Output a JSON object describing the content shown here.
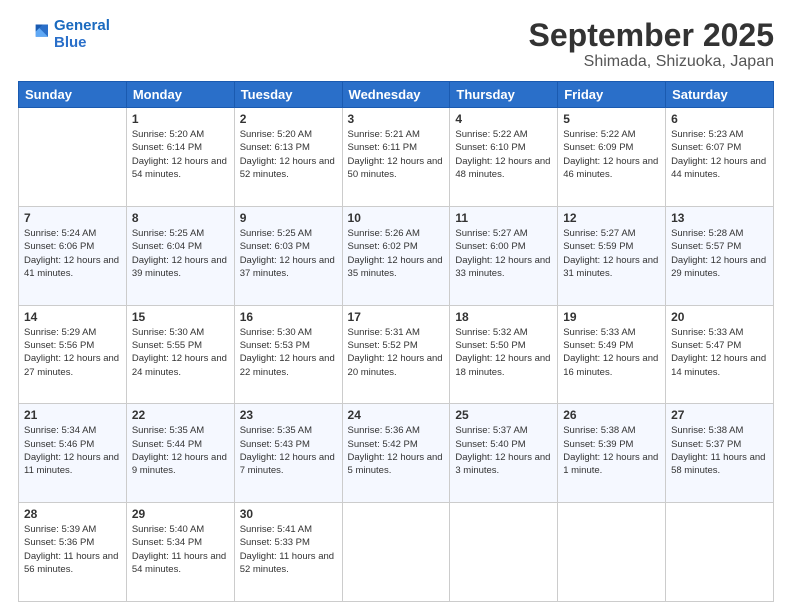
{
  "logo": {
    "line1": "General",
    "line2": "Blue"
  },
  "header": {
    "month": "September 2025",
    "location": "Shimada, Shizuoka, Japan"
  },
  "weekdays": [
    "Sunday",
    "Monday",
    "Tuesday",
    "Wednesday",
    "Thursday",
    "Friday",
    "Saturday"
  ],
  "weeks": [
    [
      null,
      {
        "day": "1",
        "sunrise": "Sunrise: 5:20 AM",
        "sunset": "Sunset: 6:14 PM",
        "daylight": "Daylight: 12 hours and 54 minutes."
      },
      {
        "day": "2",
        "sunrise": "Sunrise: 5:20 AM",
        "sunset": "Sunset: 6:13 PM",
        "daylight": "Daylight: 12 hours and 52 minutes."
      },
      {
        "day": "3",
        "sunrise": "Sunrise: 5:21 AM",
        "sunset": "Sunset: 6:11 PM",
        "daylight": "Daylight: 12 hours and 50 minutes."
      },
      {
        "day": "4",
        "sunrise": "Sunrise: 5:22 AM",
        "sunset": "Sunset: 6:10 PM",
        "daylight": "Daylight: 12 hours and 48 minutes."
      },
      {
        "day": "5",
        "sunrise": "Sunrise: 5:22 AM",
        "sunset": "Sunset: 6:09 PM",
        "daylight": "Daylight: 12 hours and 46 minutes."
      },
      {
        "day": "6",
        "sunrise": "Sunrise: 5:23 AM",
        "sunset": "Sunset: 6:07 PM",
        "daylight": "Daylight: 12 hours and 44 minutes."
      }
    ],
    [
      {
        "day": "7",
        "sunrise": "Sunrise: 5:24 AM",
        "sunset": "Sunset: 6:06 PM",
        "daylight": "Daylight: 12 hours and 41 minutes."
      },
      {
        "day": "8",
        "sunrise": "Sunrise: 5:25 AM",
        "sunset": "Sunset: 6:04 PM",
        "daylight": "Daylight: 12 hours and 39 minutes."
      },
      {
        "day": "9",
        "sunrise": "Sunrise: 5:25 AM",
        "sunset": "Sunset: 6:03 PM",
        "daylight": "Daylight: 12 hours and 37 minutes."
      },
      {
        "day": "10",
        "sunrise": "Sunrise: 5:26 AM",
        "sunset": "Sunset: 6:02 PM",
        "daylight": "Daylight: 12 hours and 35 minutes."
      },
      {
        "day": "11",
        "sunrise": "Sunrise: 5:27 AM",
        "sunset": "Sunset: 6:00 PM",
        "daylight": "Daylight: 12 hours and 33 minutes."
      },
      {
        "day": "12",
        "sunrise": "Sunrise: 5:27 AM",
        "sunset": "Sunset: 5:59 PM",
        "daylight": "Daylight: 12 hours and 31 minutes."
      },
      {
        "day": "13",
        "sunrise": "Sunrise: 5:28 AM",
        "sunset": "Sunset: 5:57 PM",
        "daylight": "Daylight: 12 hours and 29 minutes."
      }
    ],
    [
      {
        "day": "14",
        "sunrise": "Sunrise: 5:29 AM",
        "sunset": "Sunset: 5:56 PM",
        "daylight": "Daylight: 12 hours and 27 minutes."
      },
      {
        "day": "15",
        "sunrise": "Sunrise: 5:30 AM",
        "sunset": "Sunset: 5:55 PM",
        "daylight": "Daylight: 12 hours and 24 minutes."
      },
      {
        "day": "16",
        "sunrise": "Sunrise: 5:30 AM",
        "sunset": "Sunset: 5:53 PM",
        "daylight": "Daylight: 12 hours and 22 minutes."
      },
      {
        "day": "17",
        "sunrise": "Sunrise: 5:31 AM",
        "sunset": "Sunset: 5:52 PM",
        "daylight": "Daylight: 12 hours and 20 minutes."
      },
      {
        "day": "18",
        "sunrise": "Sunrise: 5:32 AM",
        "sunset": "Sunset: 5:50 PM",
        "daylight": "Daylight: 12 hours and 18 minutes."
      },
      {
        "day": "19",
        "sunrise": "Sunrise: 5:33 AM",
        "sunset": "Sunset: 5:49 PM",
        "daylight": "Daylight: 12 hours and 16 minutes."
      },
      {
        "day": "20",
        "sunrise": "Sunrise: 5:33 AM",
        "sunset": "Sunset: 5:47 PM",
        "daylight": "Daylight: 12 hours and 14 minutes."
      }
    ],
    [
      {
        "day": "21",
        "sunrise": "Sunrise: 5:34 AM",
        "sunset": "Sunset: 5:46 PM",
        "daylight": "Daylight: 12 hours and 11 minutes."
      },
      {
        "day": "22",
        "sunrise": "Sunrise: 5:35 AM",
        "sunset": "Sunset: 5:44 PM",
        "daylight": "Daylight: 12 hours and 9 minutes."
      },
      {
        "day": "23",
        "sunrise": "Sunrise: 5:35 AM",
        "sunset": "Sunset: 5:43 PM",
        "daylight": "Daylight: 12 hours and 7 minutes."
      },
      {
        "day": "24",
        "sunrise": "Sunrise: 5:36 AM",
        "sunset": "Sunset: 5:42 PM",
        "daylight": "Daylight: 12 hours and 5 minutes."
      },
      {
        "day": "25",
        "sunrise": "Sunrise: 5:37 AM",
        "sunset": "Sunset: 5:40 PM",
        "daylight": "Daylight: 12 hours and 3 minutes."
      },
      {
        "day": "26",
        "sunrise": "Sunrise: 5:38 AM",
        "sunset": "Sunset: 5:39 PM",
        "daylight": "Daylight: 12 hours and 1 minute."
      },
      {
        "day": "27",
        "sunrise": "Sunrise: 5:38 AM",
        "sunset": "Sunset: 5:37 PM",
        "daylight": "Daylight: 11 hours and 58 minutes."
      }
    ],
    [
      {
        "day": "28",
        "sunrise": "Sunrise: 5:39 AM",
        "sunset": "Sunset: 5:36 PM",
        "daylight": "Daylight: 11 hours and 56 minutes."
      },
      {
        "day": "29",
        "sunrise": "Sunrise: 5:40 AM",
        "sunset": "Sunset: 5:34 PM",
        "daylight": "Daylight: 11 hours and 54 minutes."
      },
      {
        "day": "30",
        "sunrise": "Sunrise: 5:41 AM",
        "sunset": "Sunset: 5:33 PM",
        "daylight": "Daylight: 11 hours and 52 minutes."
      },
      null,
      null,
      null,
      null
    ]
  ]
}
